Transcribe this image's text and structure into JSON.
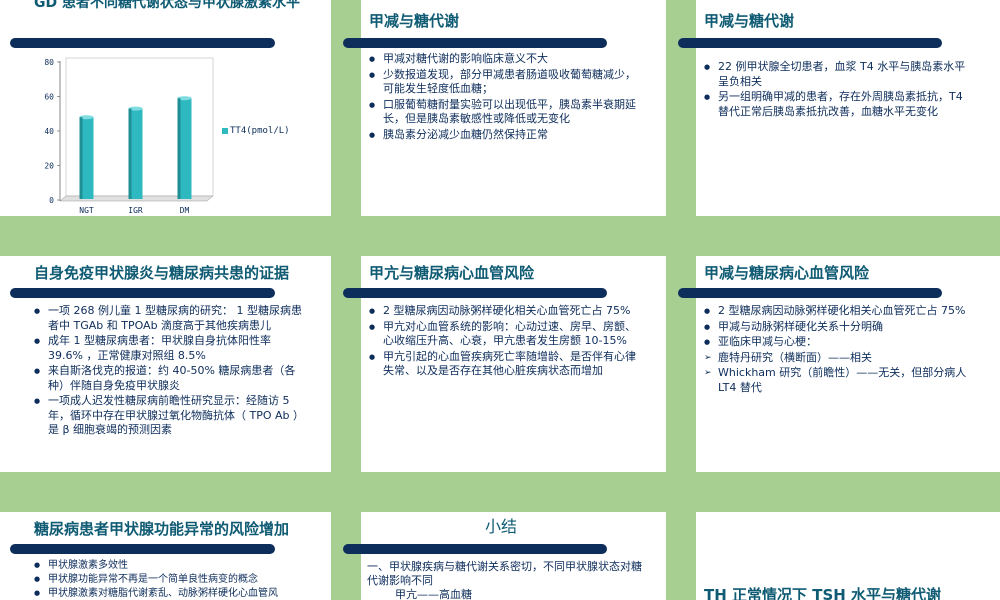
{
  "colors": {
    "accent": "#0d2d5b",
    "title": "#0f5b73",
    "side": "#a8cf92",
    "bar": "#2eb8bf"
  },
  "s1": {
    "title": "GD 患者不同糖代谢状态与甲状腺激素水平",
    "legend": "TT4(pmol/L)"
  },
  "chart_data": {
    "type": "bar",
    "categories": [
      "NGT",
      "IGR",
      "DM"
    ],
    "values": [
      48,
      53,
      59
    ],
    "series": [
      {
        "name": "TT4(pmol/L)",
        "values": [
          48,
          53,
          59
        ]
      }
    ],
    "yticks": [
      0,
      20,
      40,
      60,
      80
    ],
    "ylim": [
      0,
      80
    ]
  },
  "s2": {
    "title": "甲减与糖代谢",
    "items": [
      "甲减对糖代谢的影响临床意义不大",
      "少数报道发现，部分甲减患者肠道吸收葡萄糖减少，可能发生轻度低血糖；",
      "口服葡萄糖耐量实验可以出现低平，胰岛素半衰期延长，但是胰岛素敏感性或降低或无变化",
      "胰岛素分泌减少血糖仍然保持正常"
    ]
  },
  "s3": {
    "title": "甲减与糖代谢",
    "items": [
      "22 例甲状腺全切患者，血浆 T4 水平与胰岛素水平呈负相关",
      "另一组明确甲减的患者，存在外周胰岛素抵抗，T4 替代正常后胰岛素抵抗改善，血糖水平无变化"
    ]
  },
  "s4": {
    "title": "自身免疫甲状腺炎与糖尿病共患的证据",
    "items": [
      "一项 268 例儿童 1 型糖尿病的研究： 1 型糖尿病患者中 TGAb 和 TPOAb 滴度高于其他疾病患儿",
      "成年 1 型糖尿病患者：甲状腺自身抗体阳性率 39.6% ，正常健康对照组 8.5%",
      "来自斯洛伐克的报道：约 40-50% 糖尿病患者（各种）伴随自身免疫甲状腺炎",
      "一项成人迟发性糖尿病前瞻性研究显示：经随访 5 年，循环中存在甲状腺过氧化物酶抗体（ TPO Ab ）是 β 细胞衰竭的预测因素"
    ]
  },
  "s5": {
    "title": "甲亢与糖尿病心血管风险",
    "items": [
      "2 型糖尿病因动脉粥样硬化相关心血管死亡占 75%",
      "甲亢对心血管系统的影响：心动过速、房早、房颤、心收缩压升高、心衰，甲亢患者发生房颤 10-15%",
      "甲亢引起的心血管疾病死亡率随增龄、是否伴有心律失常、以及是否存在其他心脏疾病状态而增加"
    ]
  },
  "s6": {
    "title": "甲减与糖尿病心血管风险",
    "items": [
      "2 型糖尿病因动脉粥样硬化相关心血管死亡占 75%",
      "甲减与动脉粥样硬化关系十分明确",
      "亚临床甲减与心梗："
    ],
    "subitems": [
      "鹿特丹研究（横断面）——相关",
      "Whickham 研究（前瞻性）——无关，但部分病人 LT4 替代"
    ]
  },
  "s7": {
    "title": "糖尿病患者甲状腺功能异常的风险增加",
    "items": [
      "甲状腺激素多效性",
      "甲状腺功能异常不再是一个简单良性病变的概念",
      "甲状腺激素对糖脂代谢紊乱、动脉粥样硬化心血管风"
    ]
  },
  "s8": {
    "title": "小结",
    "line1": "一、甲状腺疾病与糖代谢关系密切，不同甲状腺状态对糖代谢影响不同",
    "line2": "甲亢——高血糖"
  },
  "s9": {
    "title": "TH 正常情况下 TSH 水平与糖代谢"
  }
}
